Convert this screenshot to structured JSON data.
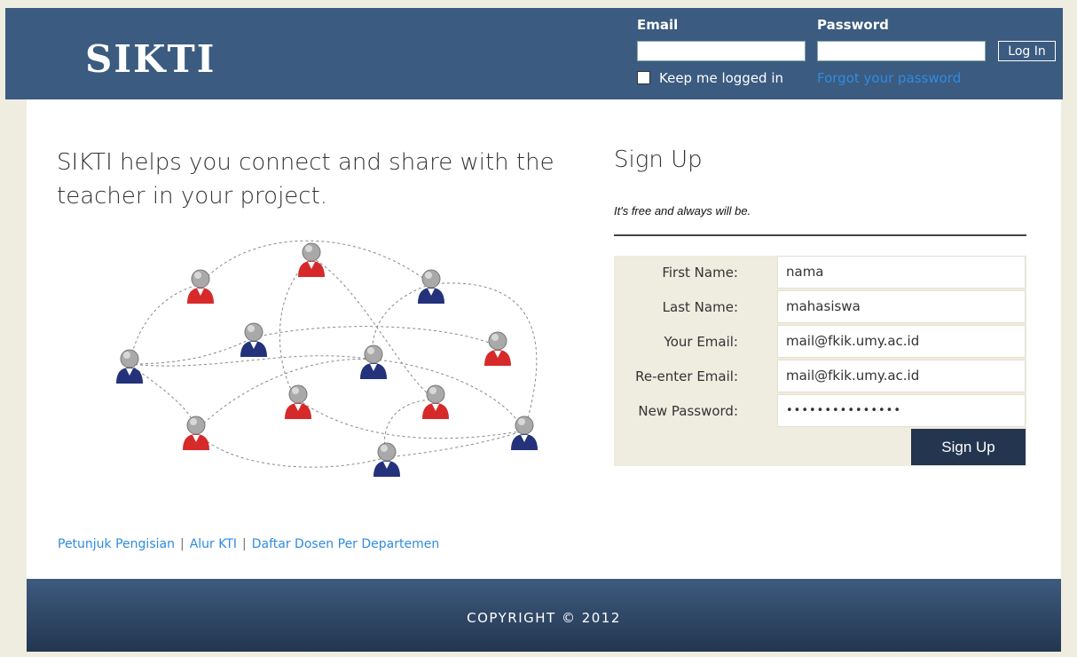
{
  "header": {
    "logo": "SIKTI",
    "email_label": "Email",
    "password_label": "Password",
    "login_button": "Log In",
    "keep_logged_in": "Keep me logged in",
    "forgot_password": "Forgot your password"
  },
  "intro": {
    "tagline": "SIKTI helps you connect and share with the teacher in your project."
  },
  "signup": {
    "title": "Sign Up",
    "subtitle": "It's free and always will be.",
    "fields": [
      {
        "label": "First Name:",
        "value": "nama"
      },
      {
        "label": "Last Name:",
        "value": "mahasiswa"
      },
      {
        "label": "Your Email:",
        "value": "mail@fkik.umy.ac.id"
      },
      {
        "label": "Re-enter Email:",
        "value": "mail@fkik.umy.ac.id"
      },
      {
        "label": "New Password:",
        "value": "•••••••••••••••"
      }
    ],
    "button": "Sign Up"
  },
  "links": {
    "link1": "Petunjuk Pengisian",
    "link2": "Alur KTI",
    "link3": "Daftar Dosen Per Departemen",
    "separator": "|"
  },
  "footer": {
    "copyright": "COPYRIGHT © 2012"
  },
  "colors": {
    "header_bg": "#3b5b80",
    "link": "#2f8be0",
    "signup_button": "#243550",
    "person_red": "#d62a2a",
    "person_blue": "#23327a"
  }
}
